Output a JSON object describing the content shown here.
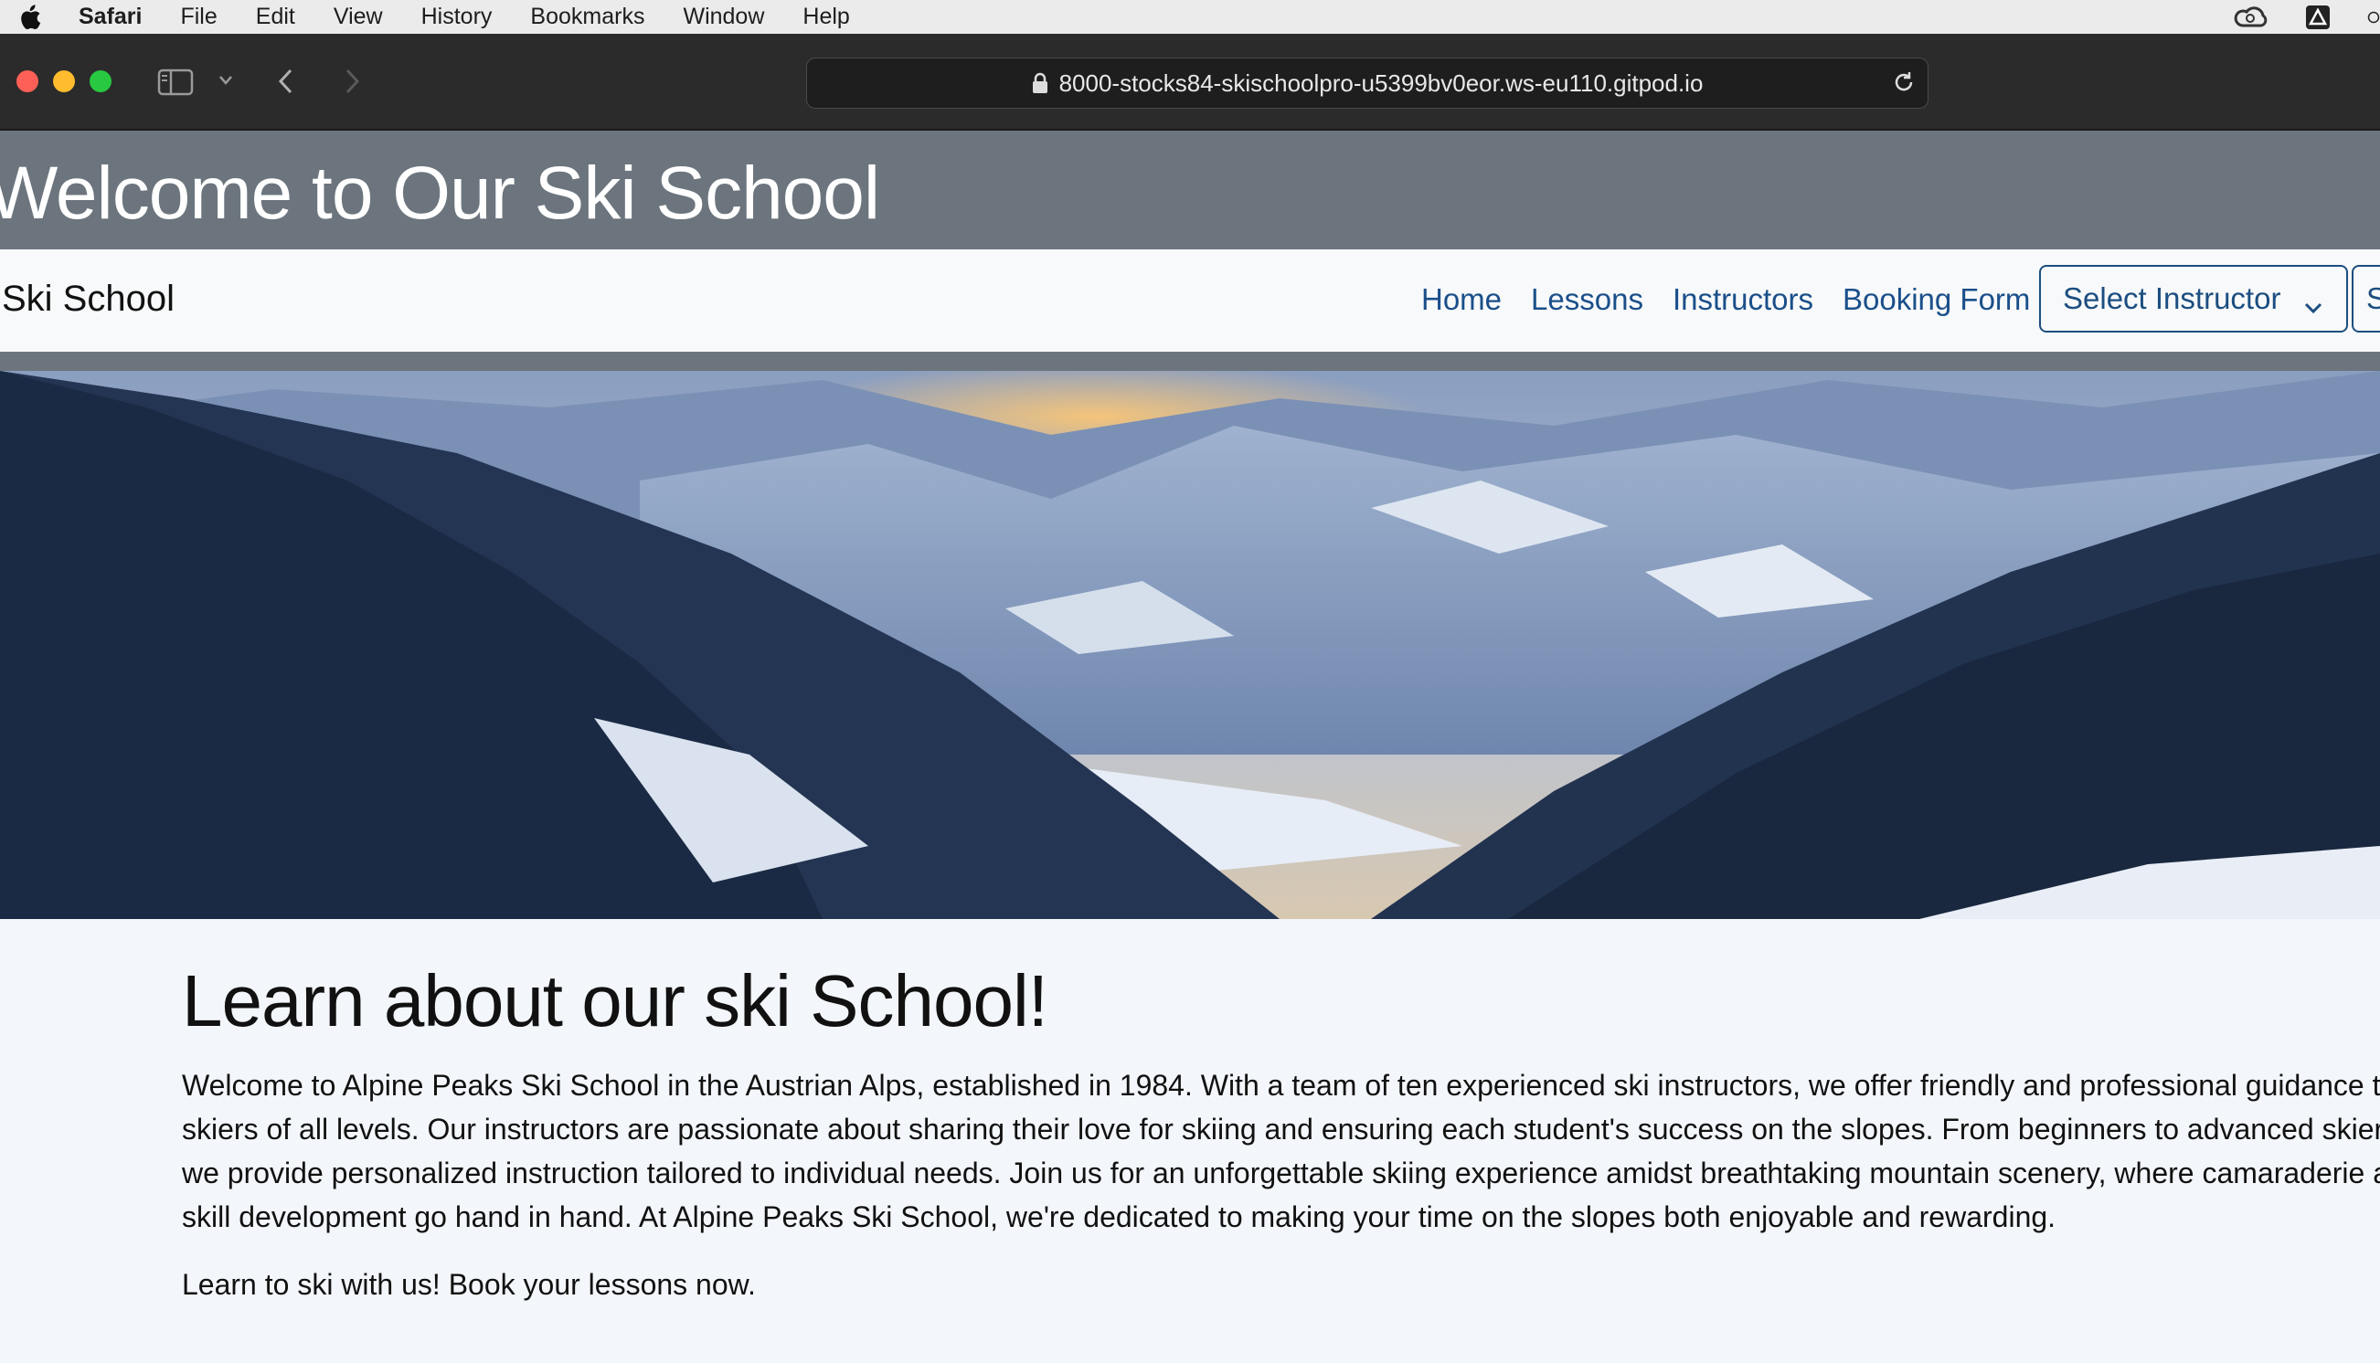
{
  "menubar": {
    "app": "Safari",
    "items": [
      "File",
      "Edit",
      "View",
      "History",
      "Bookmarks",
      "Window",
      "Help"
    ]
  },
  "browser": {
    "url": "8000-stocks84-skischoolpro-u5399bv0eor.ws-eu110.gitpod.io"
  },
  "page": {
    "header_title": "Welcome to Our Ski School",
    "brand": "Ski School",
    "nav": {
      "home": "Home",
      "lessons": "Lessons",
      "instructors": "Instructors",
      "booking": "Booking Form"
    },
    "instructor_select": "Select Instructor",
    "second_select_partial": "S",
    "section_title": "Learn about our ski School!",
    "intro": "Welcome to Alpine Peaks Ski School in the Austrian Alps, established in 1984. With a team of ten experienced ski instructors, we offer friendly and professional guidance to skiers of all levels. Our instructors are passionate about sharing their love for skiing and ensuring each student's success on the slopes. From beginners to advanced skiers, we provide personalized instruction tailored to individual needs. Join us for an unforgettable skiing experience amidst breathtaking mountain scenery, where camaraderie and skill development go hand in hand. At Alpine Peaks Ski School, we're dedicated to making your time on the slopes both enjoyable and rewarding.",
    "cta": "Learn to ski with us! Book your lessons now."
  },
  "colors": {
    "header_bg": "#6c757d",
    "nav_link": "#1a4f8a",
    "page_bg": "#f3f6fa"
  }
}
